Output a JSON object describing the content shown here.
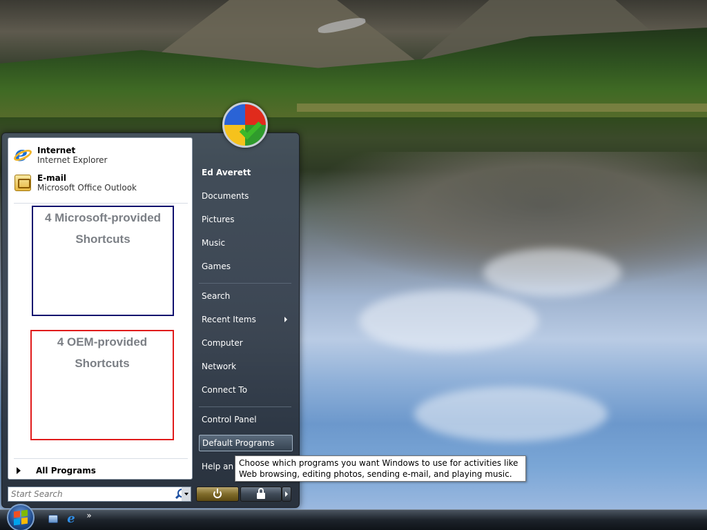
{
  "pinned": [
    {
      "title": "Internet",
      "subtitle": "Internet Explorer",
      "icon": "internet-explorer-icon"
    },
    {
      "title": "E-mail",
      "subtitle": "Microsoft Office Outlook",
      "icon": "outlook-icon"
    }
  ],
  "annotations": {
    "ms_line1": "4 Microsoft-provided",
    "ms_line2": "Shortcuts",
    "ms_border_color": "#10106E",
    "oem_line1": "4 OEM-provided",
    "oem_line2": "Shortcuts",
    "oem_border_color": "#E01A1A"
  },
  "all_programs": "All Programs",
  "search": {
    "placeholder": "Start Search"
  },
  "right_pane": {
    "user": "Ed Averett",
    "documents": "Documents",
    "pictures": "Pictures",
    "music": "Music",
    "games": "Games",
    "search": "Search",
    "recent_items": "Recent Items",
    "computer": "Computer",
    "network": "Network",
    "connect_to": "Connect To",
    "control_panel": "Control Panel",
    "default_programs": "Default Programs",
    "help": "Help and Support"
  },
  "tooltip": "Choose which programs you want Windows to use for activities like Web browsing, editing photos, sending e-mail, and playing music.",
  "taskbar": {
    "overflow": "»"
  }
}
